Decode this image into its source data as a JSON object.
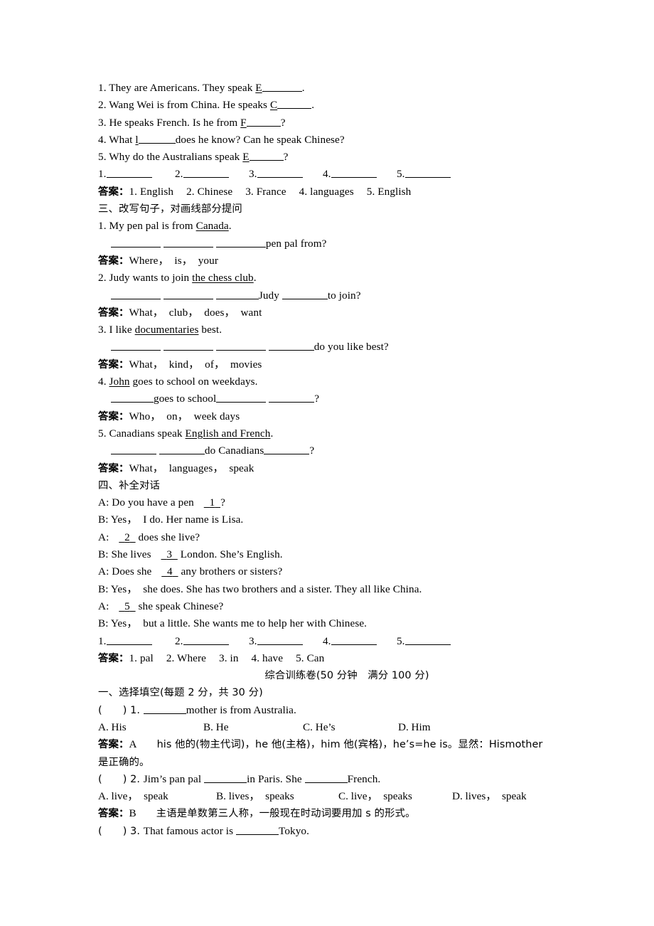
{
  "document": {
    "section_two_fill": {
      "items": [
        "1. They are Americans. They speak ",
        "2. Wang Wei is from China. He speaks ",
        "3. He speaks French. Is he from ",
        "4. What ",
        "5. Why do the Australians speak "
      ],
      "hints": [
        "E",
        "C",
        "F",
        "l",
        "E"
      ],
      "tails": [
        ".",
        ".",
        "?",
        "does he know? Can he speak Chinese?",
        "?"
      ],
      "answer_label": "答案：",
      "answers": [
        "1. English",
        "2. Chinese",
        "3. France",
        "4. languages",
        "5. English"
      ],
      "blank_numbers": [
        "1.",
        "2.",
        "3.",
        "4.",
        "5."
      ]
    },
    "section_three": {
      "heading": "三、改写句子，对画线部分提问",
      "answer_label": "答案：",
      "questions": [
        {
          "prompt_pre": "1. My pen pal is from ",
          "prompt_underlined": "Canada",
          "prompt_post": ".",
          "blank_tail": "pen pal from?",
          "answer": "Where，　is，　your"
        },
        {
          "prompt_pre": "2. Judy wants to join ",
          "prompt_underlined": "the chess club",
          "prompt_post": ".",
          "blank_mid": "Judy",
          "blank_tail": "to join?",
          "answer": "What，　club，　does，　want"
        },
        {
          "prompt_pre": "3. I like ",
          "prompt_underlined": "documentaries",
          "prompt_post": " best.",
          "blank_tail": "do you like best?",
          "answer": "What，　kind，　of，　movies"
        },
        {
          "prompt_pre": "4. ",
          "prompt_underlined": "John",
          "prompt_post": " goes to school on weekdays.",
          "blank_mid": "goes to school",
          "blank_tail": "?",
          "answer": "Who，　on，　week days"
        },
        {
          "prompt_pre": "5. Canadians speak ",
          "prompt_underlined": "English and French",
          "prompt_post": ".",
          "blank_mid": "do Canadians",
          "blank_tail": "?",
          "answer": "What，　languages，　speak"
        }
      ]
    },
    "section_four": {
      "heading": "四、补全对话",
      "lines": [
        {
          "speaker": "A: ",
          "pre": "Do you have a pen ",
          "blank": "1",
          "post": "?"
        },
        {
          "speaker": "B: ",
          "pre": "Yes，　I do. Her name is Lisa.",
          "blank": "",
          "post": ""
        },
        {
          "speaker": "A: ",
          "pre": "",
          "blank": "2",
          "post": " does she live?"
        },
        {
          "speaker": "B: ",
          "pre": "She lives ",
          "blank": "3",
          "post": " London. She’s English."
        },
        {
          "speaker": "A: ",
          "pre": "Does she ",
          "blank": "4",
          "post": " any brothers or sisters?"
        },
        {
          "speaker": "B: ",
          "pre": "Yes，　she does. She has two brothers and a sister. They all like China.",
          "blank": "",
          "post": ""
        },
        {
          "speaker": "A: ",
          "pre": "",
          "blank": "5",
          "post": " she speak Chinese?"
        },
        {
          "speaker": "B: ",
          "pre": "Yes，　but a little. She wants me to help her with Chinese.",
          "blank": "",
          "post": ""
        }
      ],
      "blank_numbers": [
        "1.",
        "2.",
        "3.",
        "4.",
        "5."
      ],
      "answer_label": "答案：",
      "answers": [
        "1. pal",
        "2. Where",
        "3. in",
        "4. have",
        "5. Can"
      ]
    },
    "exam": {
      "title": "综合训练卷(50 分钟　满分 100 分)",
      "section_one_heading": "一、选择填空(每题 2 分，共 30 分)",
      "answer_label": "答案：",
      "questions": [
        {
          "bracket": "(　　) 1. ",
          "stem_post": "mother is from Australia.",
          "options": [
            "A. His",
            "B. He",
            "C. He’s",
            "D. Him"
          ],
          "answer_key": "A",
          "explanation_line1": "his 他的(物主代词)，he 他(主格)，him 他(宾格)，he’s=he is。显然：Hismother",
          "explanation_line2": "是正确的。"
        },
        {
          "bracket": "(　　) 2. ",
          "stem_pre": "Jim’s pan pal ",
          "stem_mid": "in Paris. She ",
          "stem_post": "French.",
          "options": [
            "A. live，　speak",
            "B. lives，　speaks",
            "C. live，　speaks",
            "D. lives，　speak"
          ],
          "answer_key": "B",
          "explanation_line1": "主语是单数第三人称，一般现在时动词要用加 s 的形式。"
        },
        {
          "bracket": "(　　) 3. ",
          "stem_pre": "That famous actor is ",
          "stem_post": "Tokyo."
        }
      ]
    }
  }
}
